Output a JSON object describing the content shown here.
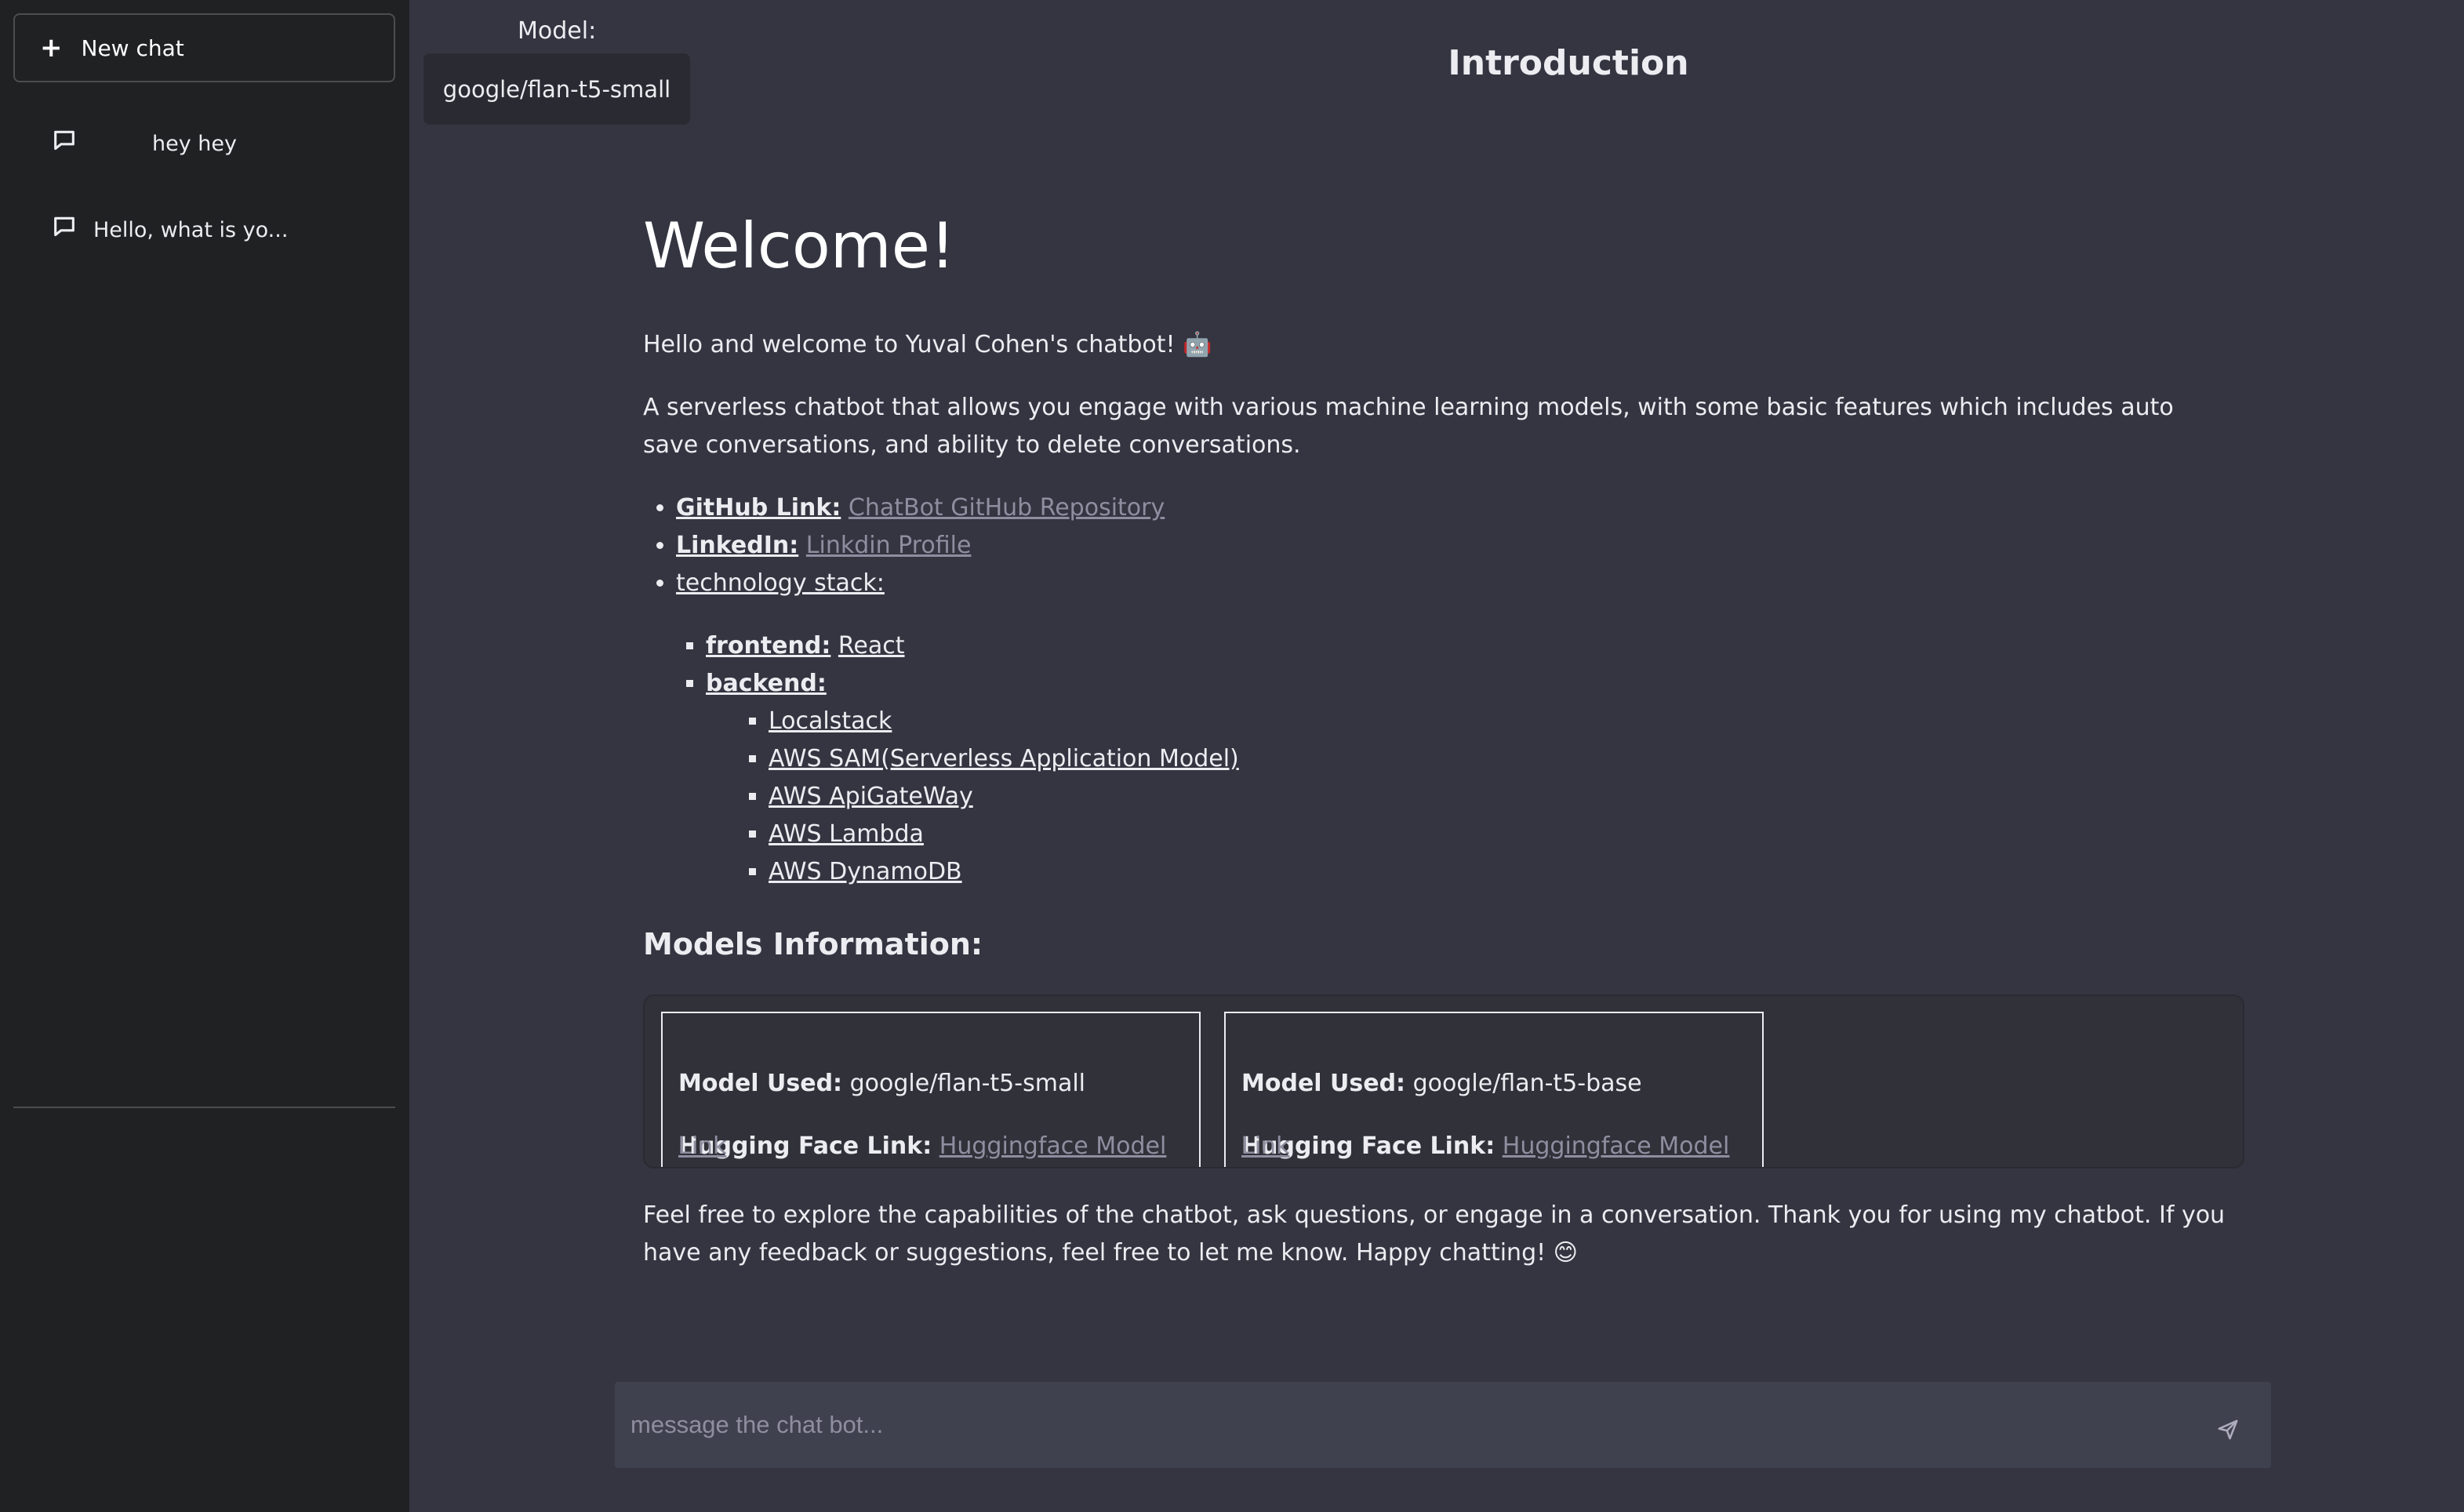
{
  "sidebar": {
    "new_chat_label": "New chat",
    "chats": [
      {
        "label": "hey hey",
        "icon": "chat-bubble-icon"
      },
      {
        "label": "Hello, what is yo...",
        "icon": "chat-bubble-icon"
      }
    ]
  },
  "header": {
    "model_label": "Model:",
    "model_value": "google/flan-t5-small",
    "title": "Introduction"
  },
  "main": {
    "welcome": "Welcome!",
    "intro": "Hello and welcome to Yuval Cohen's chatbot! 🤖",
    "description": "A serverless chatbot that allows you engage with various machine learning models, with some basic features which includes auto save conversations, and ability to delete conversations.",
    "links": {
      "github_label": "GitHub Link:",
      "github_text": "ChatBot GitHub Repository",
      "linkedin_label": "LinkedIn:",
      "linkedin_text": "Linkdin Profile",
      "stack_label": "technology stack:"
    },
    "stack": {
      "frontend_label": "frontend:",
      "frontend_value": "React",
      "backend_label": "backend:",
      "backend_items": [
        "Localstack",
        "AWS SAM(Serverless Application Model)",
        "AWS ApiGateWay",
        "AWS Lambda",
        "AWS DynamoDB"
      ]
    },
    "models_heading": "Models Information:",
    "models": [
      {
        "used_label": "Model Used:",
        "used_value": "google/flan-t5-small",
        "link_label": "Hugging Face Link:",
        "link_text": "Huggingface Model Link"
      },
      {
        "used_label": "Model Used:",
        "used_value": "google/flan-t5-base",
        "link_label": "Hugging Face Link:",
        "link_text": "Huggingface Model Link"
      }
    ],
    "outro": "Feel free to explore the capabilities of the chatbot, ask questions, or engage in a conversation. Thank you for using my chatbot. If you have any feedback or suggestions, feel free to let me know. Happy chatting! 😊"
  },
  "input": {
    "placeholder": "message the chat bot...",
    "send_icon": "send-icon"
  },
  "colors": {
    "main_bg": "#343541",
    "sidebar_bg": "#202123",
    "input_bg": "#40414f",
    "link_dim": "#8e8ea0"
  }
}
